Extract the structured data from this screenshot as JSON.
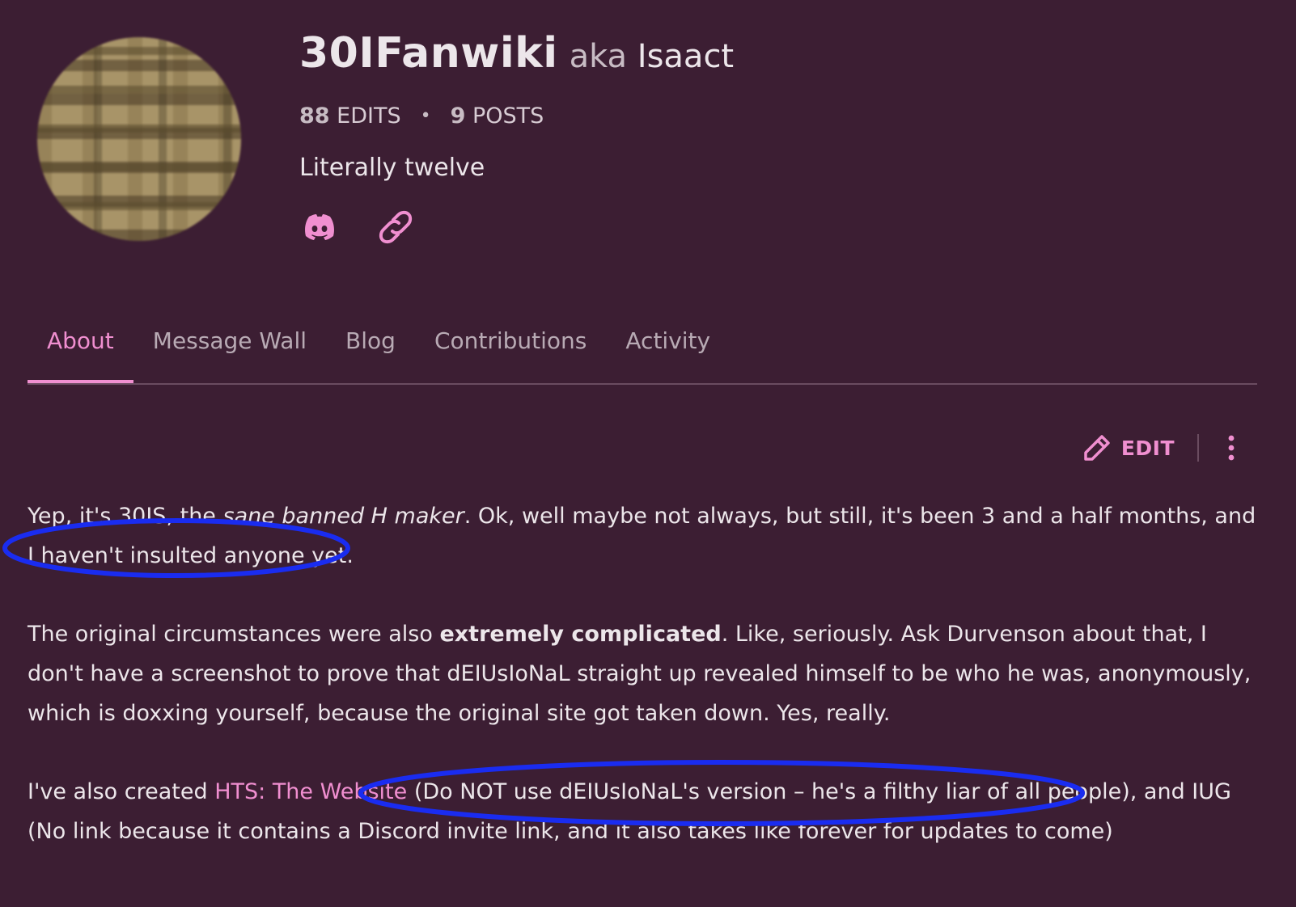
{
  "profile": {
    "username": "30IFanwiki",
    "aka_prefix": "aka",
    "aka_name": "Isaact",
    "edits_count": "88",
    "edits_label": "EDITS",
    "separator": "•",
    "posts_count": "9",
    "posts_label": "POSTS",
    "bio": "Literally twelve",
    "socials": [
      {
        "icon": "discord-icon"
      },
      {
        "icon": "link-icon"
      }
    ]
  },
  "tabs": [
    {
      "label": "About",
      "active": true
    },
    {
      "label": "Message Wall",
      "active": false
    },
    {
      "label": "Blog",
      "active": false
    },
    {
      "label": "Contributions",
      "active": false
    },
    {
      "label": "Activity",
      "active": false
    }
  ],
  "toolbar": {
    "edit_label": "EDIT",
    "edit_icon": "pencil-icon",
    "more_icon": "more-vertical-icon"
  },
  "content": {
    "p1": {
      "t1": "Yep, it's 30IS, the ",
      "em": "sane banned H maker",
      "t2": ". Ok, well maybe not always, but still, it's been 3 and a half months, and I haven't insulted anyone yet."
    },
    "p2": {
      "t1": "The original circumstances were also ",
      "strong": "extremely complicated",
      "t2": ". Like, seriously. Ask Durvenson about that, I don't have a screenshot to prove that dEIUsIoNaL straight up revealed himself to be who he was, anonymously, which is doxxing yourself, because the original site got taken down. Yes, really."
    },
    "p3": {
      "t1": "I've also created ",
      "link": "HTS: The Website",
      "t2": " (Do NOT use dEIUsIoNaL's version – he's a filthy liar of all people), and IUG (No link because it contains a Discord invite link, and it also takes like forever for updates to come)"
    }
  },
  "colors": {
    "background": "#3c1e33",
    "accent": "#f08fd0",
    "annotation": "#1a2cf0"
  }
}
